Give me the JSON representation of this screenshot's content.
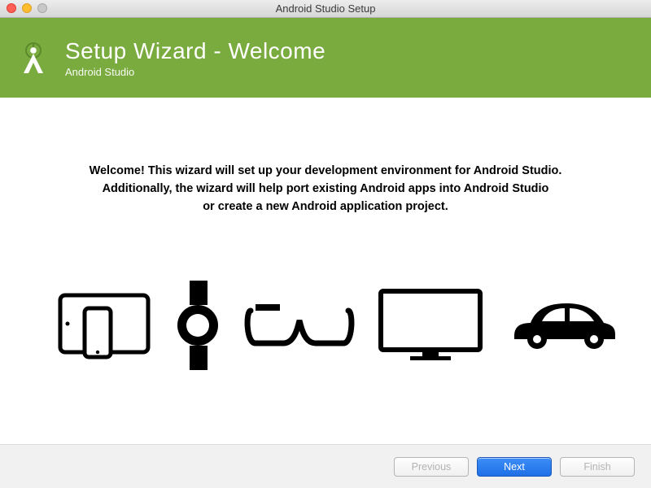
{
  "window": {
    "title": "Android Studio Setup"
  },
  "header": {
    "heading": "Setup Wizard - Welcome",
    "subtitle": "Android Studio"
  },
  "body": {
    "line1": "Welcome! This wizard will set up your development environment for Android Studio.",
    "line2": "Additionally, the wizard will help port existing Android apps into Android Studio",
    "line3": "or create a new Android application project."
  },
  "devices": {
    "tablet_phone": "tablet-phone-icon",
    "watch": "watch-icon",
    "glass": "glass-icon",
    "tv": "tv-icon",
    "car": "car-icon"
  },
  "footer": {
    "previous": "Previous",
    "next": "Next",
    "finish": "Finish"
  },
  "colors": {
    "header_bg": "#7aab3f",
    "primary_btn": "#2a78ec"
  }
}
